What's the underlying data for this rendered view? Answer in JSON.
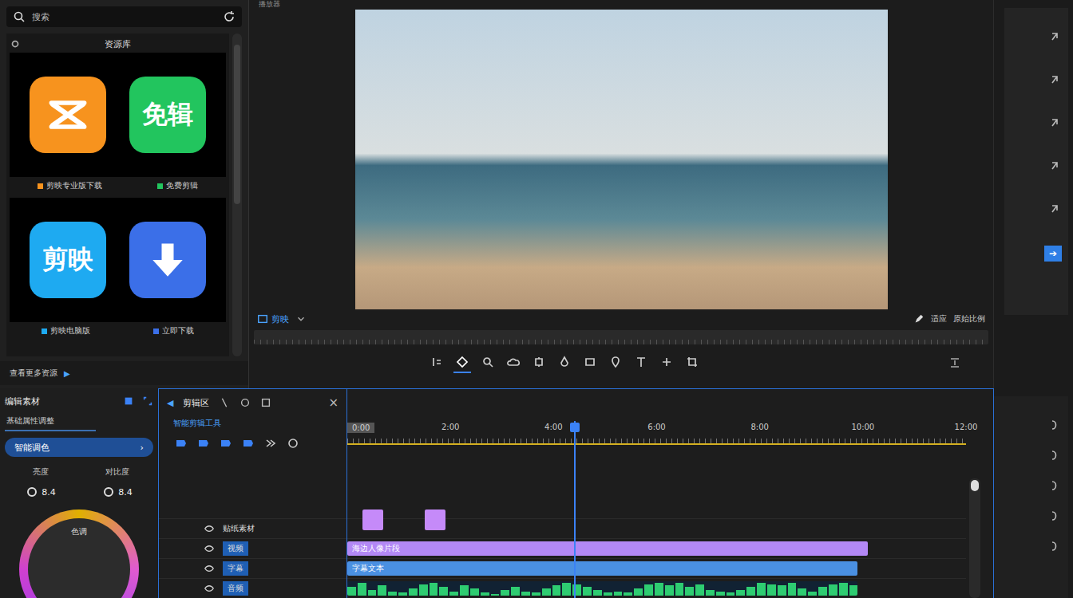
{
  "panel": {
    "search_placeholder": "搜索",
    "title": "资源库",
    "more": "查看更多资源",
    "more_icon": "▶"
  },
  "apps": [
    {
      "kind": "logo",
      "label": "剪映专业版下载",
      "color": "#f7931e"
    },
    {
      "kind": "text",
      "icon_text": "免辑",
      "label": "免费剪辑",
      "color": "#22c55e"
    },
    {
      "kind": "text",
      "icon_text": "剪映",
      "label": "剪映电脑版",
      "color": "#1eaaf1"
    },
    {
      "kind": "download",
      "label": "立即下载",
      "color": "#3b6fe8"
    }
  ],
  "preview": {
    "title": "播放器",
    "brand": "剪映",
    "fit": "适应",
    "ratio": "原始比例"
  },
  "toolbar": [
    {
      "selected": false
    },
    {
      "selected": true
    },
    {
      "selected": false
    },
    {
      "selected": false
    },
    {
      "selected": false
    },
    {
      "selected": false
    },
    {
      "selected": false
    },
    {
      "selected": false
    },
    {
      "selected": false
    },
    {
      "selected": false
    },
    {
      "selected": false
    }
  ],
  "rail": {
    "action_icon": "➔"
  },
  "inspector": {
    "title": "编辑素材",
    "subtitle": "基础属性调整",
    "button": "智能调色",
    "button_icon": "›",
    "fields": [
      {
        "label": "亮度",
        "value": "8.4"
      },
      {
        "label": "对比度",
        "value": "8.4"
      }
    ],
    "wheel_label": "色调"
  },
  "timeline": {
    "back_icon": "◀",
    "title": "剪辑区",
    "close_icon": "×",
    "subtitle": "智能剪辑工具",
    "ticks": [
      "0:00",
      "2:00",
      "4:00",
      "6:00",
      "8:00",
      "10:00",
      "12:00"
    ],
    "span": 12,
    "playhead": 4.4,
    "tracks": [
      {
        "name": "贴纸素材",
        "kind": "sticker",
        "clips": [
          {
            "start": 0.3,
            "end": 0.7,
            "color": "#c58af9"
          },
          {
            "start": 1.5,
            "end": 1.9,
            "color": "#c58af9"
          }
        ]
      },
      {
        "name": "视频",
        "kind": "video",
        "clips": [
          {
            "label": "海边人像片段",
            "start": 0,
            "end": 10.1,
            "color": "#b388f5"
          }
        ]
      },
      {
        "name": "字幕",
        "kind": "text",
        "clips": [
          {
            "label": "字幕文本",
            "start": 0,
            "end": 9.9,
            "color": "#4a90e2"
          }
        ]
      },
      {
        "name": "音频",
        "kind": "audio",
        "clips": [
          {
            "start": 0,
            "end": 9.9,
            "color": "#2ecc71"
          }
        ],
        "waveform": [
          0.6,
          0.9,
          0.4,
          0.7,
          0.3,
          0.2,
          0.5,
          0.8,
          0.9,
          0.6,
          0.3,
          0.7,
          0.5,
          0.2,
          0.1,
          0.4,
          0.6,
          0.3,
          0.2,
          0.5,
          0.7,
          0.9,
          0.8,
          0.6,
          0.4,
          0.2,
          0.3,
          0.2,
          0.5,
          0.8,
          0.9,
          0.7,
          0.9,
          0.6,
          0.8,
          0.4,
          0.3,
          0.2,
          0.4,
          0.6,
          0.9,
          0.8,
          0.7,
          0.9,
          0.5,
          0.3,
          0.6,
          0.8,
          0.9,
          0.7
        ]
      }
    ]
  }
}
